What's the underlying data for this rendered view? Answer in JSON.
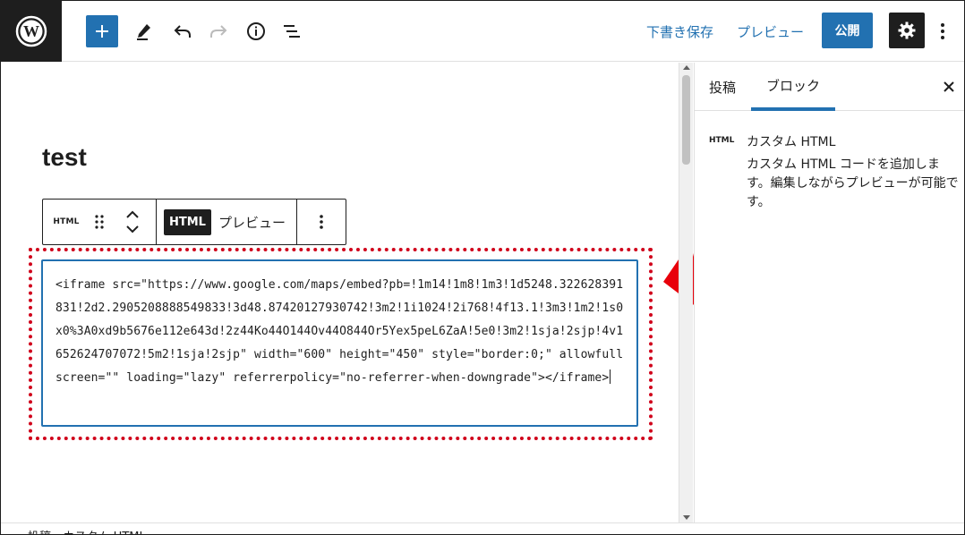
{
  "toolbar": {
    "save_draft_label": "下書き保存",
    "preview_label": "プレビュー",
    "publish_label": "公開"
  },
  "post": {
    "title": "test"
  },
  "block_toolbar": {
    "block_type_label": "HTML",
    "html_tab_label": "HTML",
    "preview_tab_label": "プレビュー"
  },
  "html_block": {
    "code": "<iframe src=\"https://www.google.com/maps/embed?pb=!1m14!1m8!1m3!1d5248.322628391831!2d2.2905208888549833!3d48.87420127930742!3m2!1i1024!2i768!4f13.1!3m3!1m2!1s0x0%3A0xd9b5676e112e643d!2z44Ko44O144Ov44O844Or5Yex5peL6ZaA!5e0!3m2!1sja!2sjp!4v1652624707072!5m2!1sja!2sjp\" width=\"600\" height=\"450\" style=\"border:0;\" allowfullscreen=\"\" loading=\"lazy\" referrerpolicy=\"no-referrer-when-downgrade\"></iframe>"
  },
  "sidebar": {
    "tab_post": "投稿",
    "tab_block": "ブロック",
    "block_icon_label": "HTML",
    "block_title": "カスタム HTML",
    "block_description": "カスタム HTML コードを追加します。編集しながらプレビューが可能です。"
  },
  "footer": {
    "breadcrumb": "投稿 › カスタム HTML"
  },
  "colors": {
    "accent": "#2271b1",
    "dark": "#1e1e1e",
    "highlight_red": "#e8000b"
  }
}
